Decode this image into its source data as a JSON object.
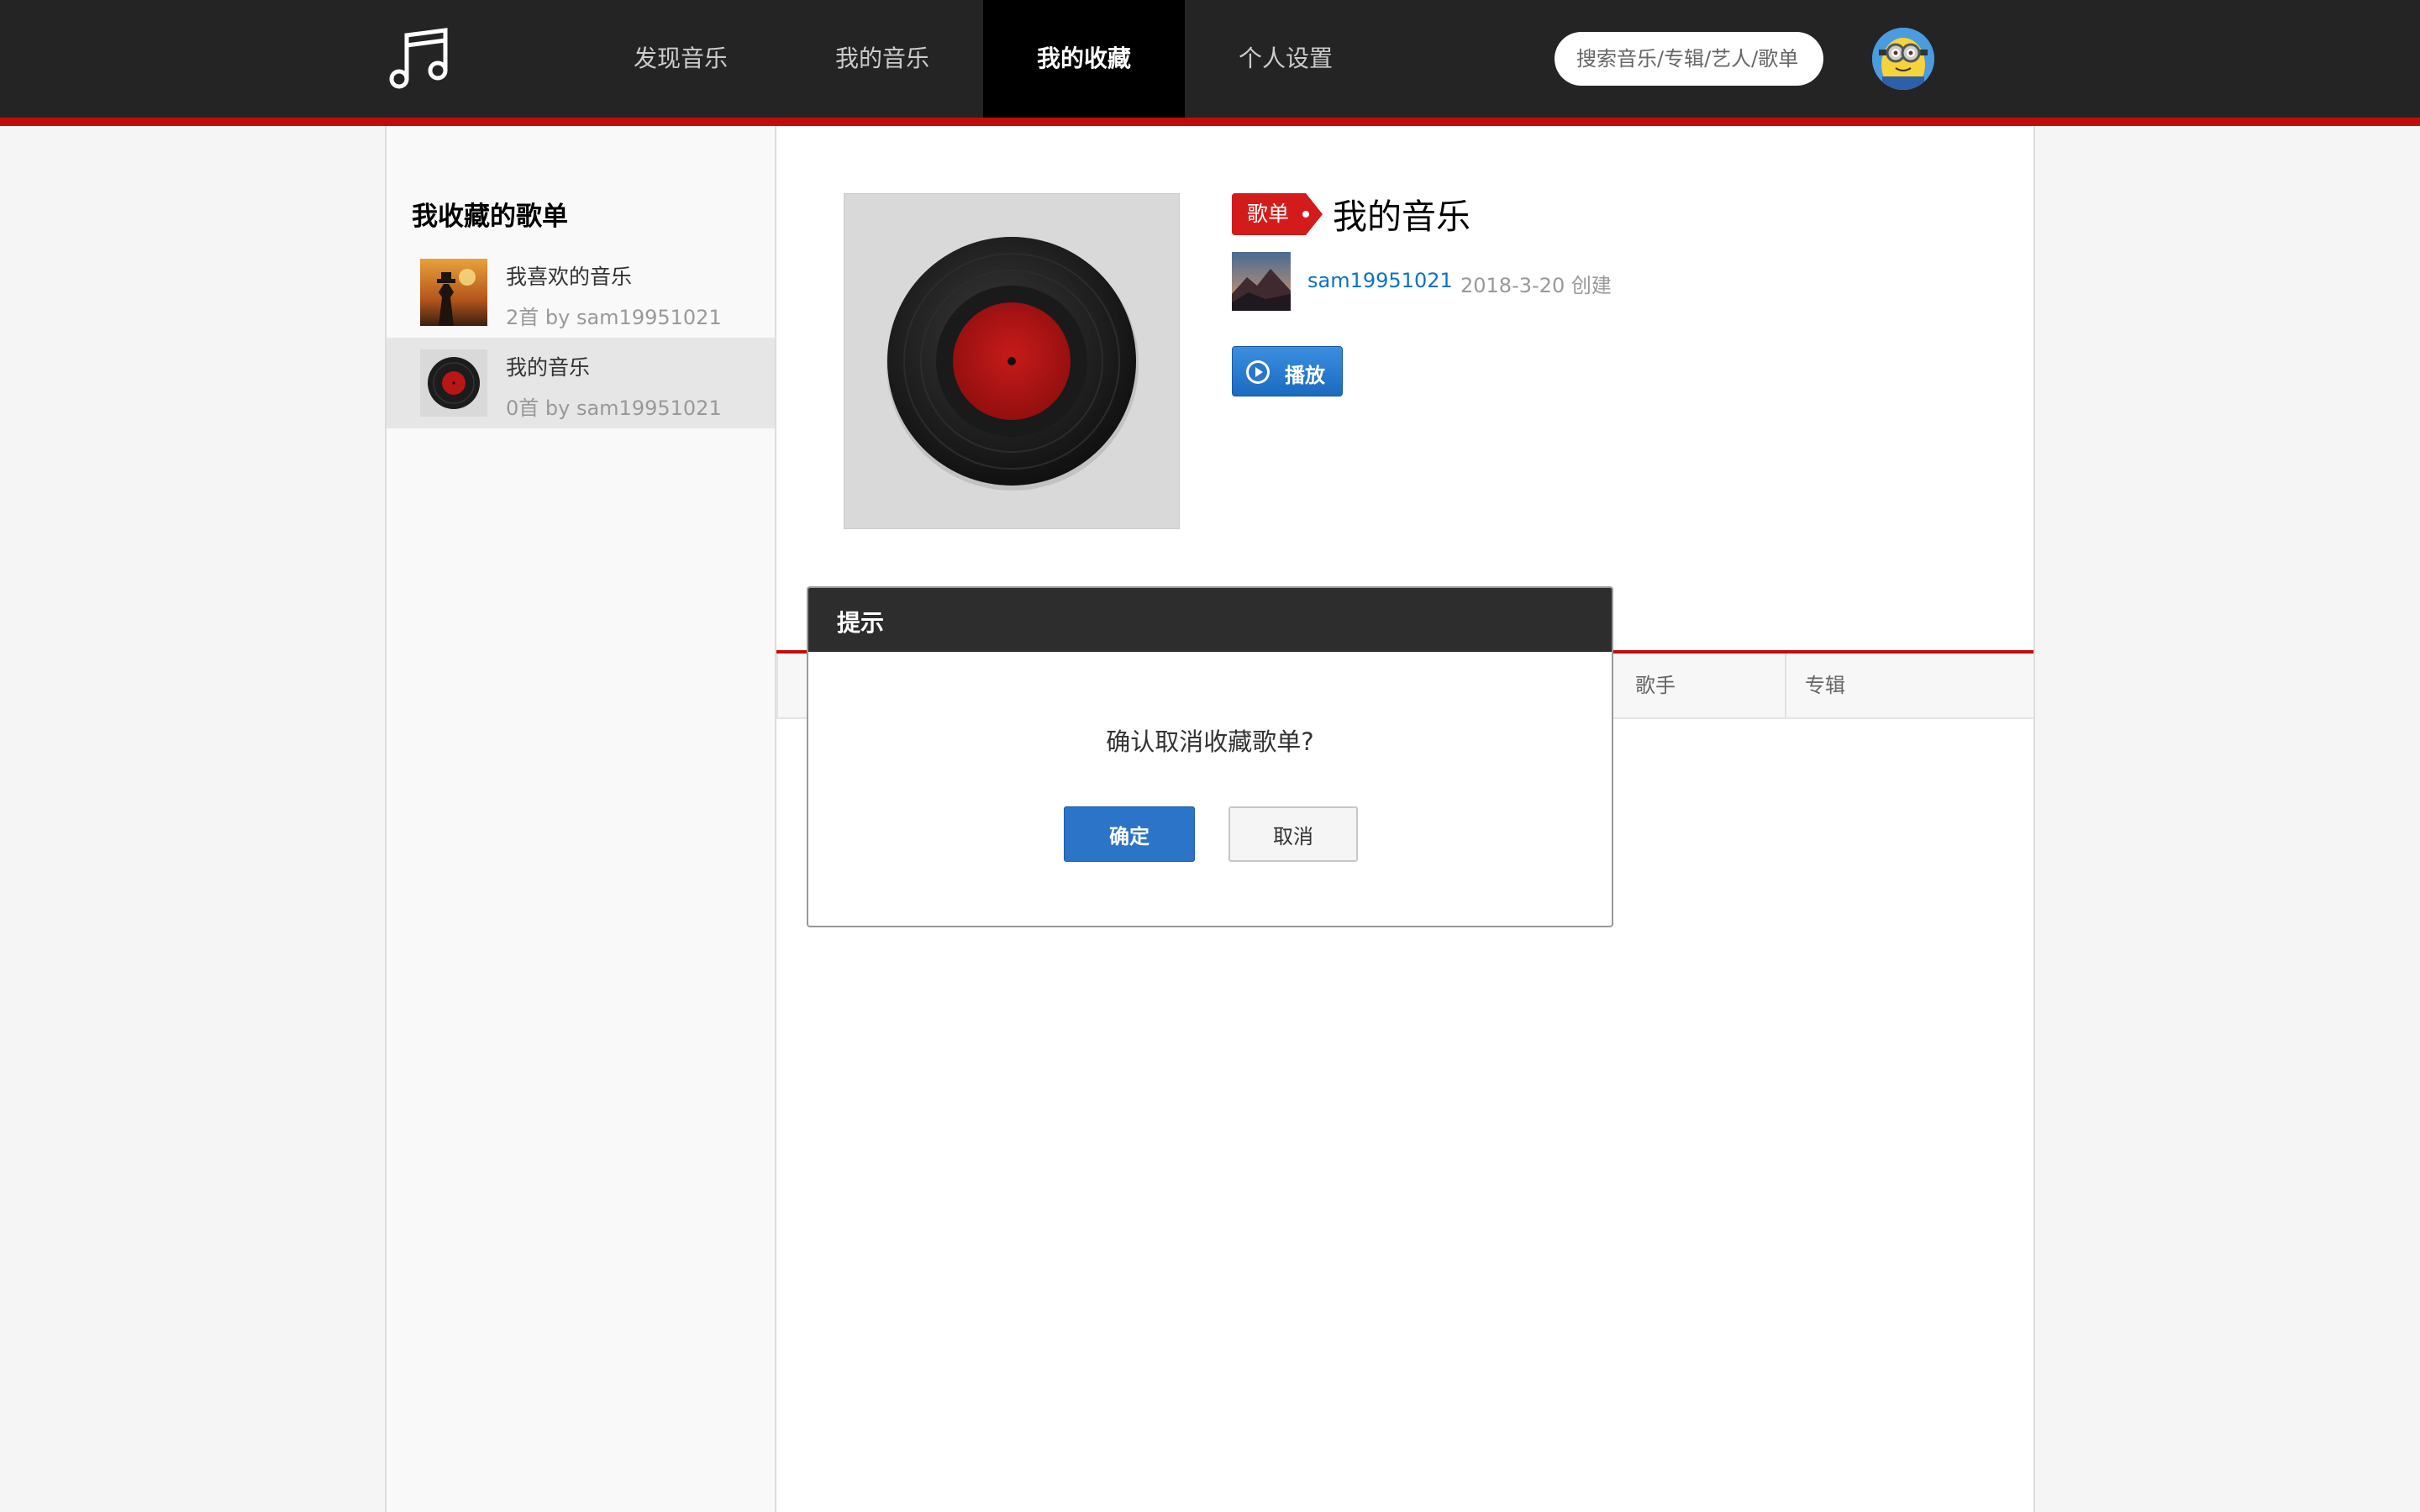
{
  "nav": {
    "items": [
      {
        "label": "发现音乐"
      },
      {
        "label": "我的音乐"
      },
      {
        "label": "我的收藏"
      },
      {
        "label": "个人设置"
      }
    ],
    "active": "我的收藏",
    "search_placeholder": "搜索音乐/专辑/艺人/歌单",
    "logo_icon": "music-note-icon",
    "avatar_icon": "user-avatar-minion"
  },
  "sidebar": {
    "title": "我收藏的歌单",
    "items": [
      {
        "name": "我喜欢的音乐",
        "meta": "2首 by sam19951021",
        "thumb": "album-cover-cowboy"
      },
      {
        "name": "我的音乐",
        "meta": "0首 by sam19951021",
        "thumb": "vinyl-record-icon"
      }
    ],
    "selected_index": 1
  },
  "playlist": {
    "tag": "歌单",
    "title": "我的音乐",
    "creator": "sam19951021",
    "created": "2018-3-20 创建",
    "play_label": "播放",
    "cover_icon": "vinyl-record-icon",
    "creator_avatar_icon": "mountain-landscape-avatar"
  },
  "table": {
    "columns": [
      "歌手",
      "专辑"
    ]
  },
  "dialog": {
    "title": "提示",
    "message": "确认取消收藏歌单?",
    "confirm_label": "确定",
    "cancel_label": "取消"
  },
  "colors": {
    "accent_red": "#c20c0c",
    "topbar": "#242424",
    "primary_blue": "#2b74c7",
    "link_blue": "#0c73c2"
  }
}
